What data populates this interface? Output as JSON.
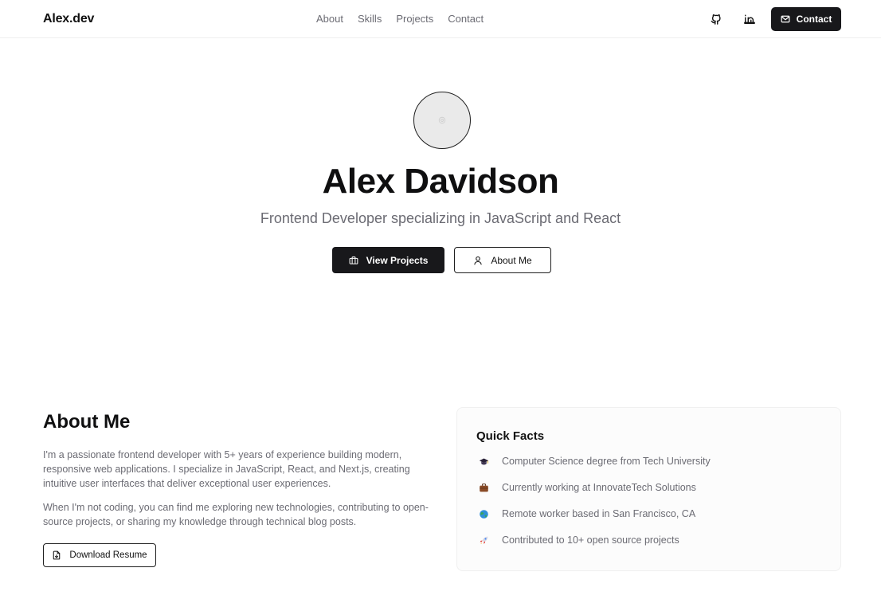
{
  "header": {
    "logo": "Alex.dev",
    "nav": [
      "About",
      "Skills",
      "Projects",
      "Contact"
    ],
    "icons": [
      "github-icon",
      "linkedin-icon"
    ],
    "contact_label": "Contact"
  },
  "hero": {
    "name": "Alex Davidson",
    "subtitle": "Frontend Developer specializing in JavaScript and React",
    "primary_label": "View Projects",
    "secondary_label": "About Me"
  },
  "about": {
    "title": "About Me",
    "p1": "I'm a passionate frontend developer with 5+ years of experience building modern, responsive web applications. I specialize in JavaScript, React, and Next.js, creating intuitive user interfaces that deliver exceptional user experiences.",
    "p2": "When I'm not coding, you can find me exploring new technologies, contributing to open-source projects, or sharing my knowledge through technical blog posts.",
    "resume_label": "Download Resume"
  },
  "quick_facts": {
    "title": "Quick Facts",
    "items": [
      {
        "icon": "graduation-cap-icon",
        "text": "Computer Science degree from Tech University"
      },
      {
        "icon": "briefcase-icon",
        "text": "Currently working at InnovateTech Solutions"
      },
      {
        "icon": "globe-icon",
        "text": "Remote worker based in San Francisco, CA"
      },
      {
        "icon": "rocket-icon",
        "text": "Contributed to 10+ open source projects"
      }
    ]
  },
  "colors": {
    "primary": "#18181b",
    "muted_text": "#6b6b73",
    "background": "#ffffff",
    "card_background": "#fcfcfc"
  }
}
